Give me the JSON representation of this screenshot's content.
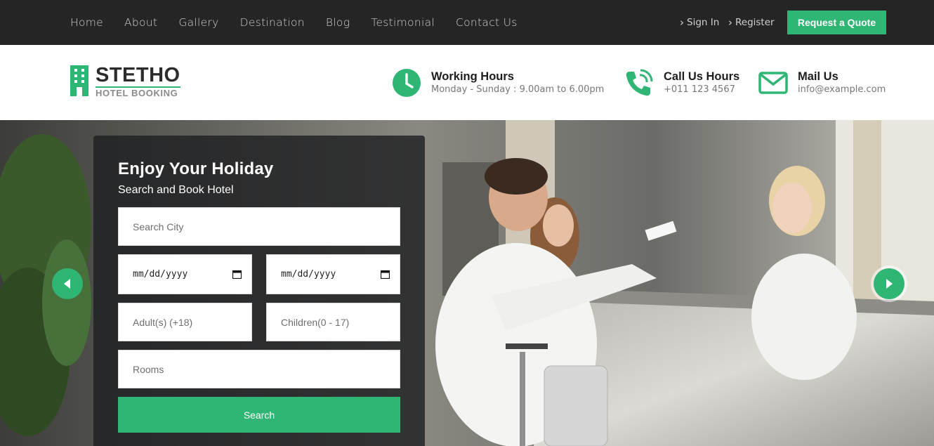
{
  "nav": {
    "items": [
      "Home",
      "About",
      "Gallery",
      "Destination",
      "Blog",
      "Testimonial",
      "Contact Us"
    ],
    "sign_in": "Sign In",
    "register": "Register",
    "quote_button": "Request a Quote"
  },
  "brand": {
    "name": "STETHO",
    "tagline": "HOTEL BOOKING",
    "accent_color": "#2fb574"
  },
  "contact": {
    "hours_title": "Working Hours",
    "hours_value": "Monday - Sunday : 9.00am to 6.00pm",
    "call_title": "Call Us Hours",
    "call_value": "+011 123 4567",
    "mail_title": "Mail Us",
    "mail_value": "info@example.com"
  },
  "booking": {
    "title": "Enjoy Your Holiday",
    "subtitle": "Search and Book Hotel",
    "city_placeholder": "Search City",
    "checkin_value": "mm/dd/yyyy",
    "checkout_value": "mm/dd/yyyy",
    "adults_placeholder": "Adult(s) (+18)",
    "children_placeholder": "Children(0 - 17)",
    "rooms_placeholder": "Rooms",
    "search_label": "Search"
  },
  "icons": {
    "logo": "building-icon",
    "hours": "clock-icon",
    "call": "phone-icon",
    "mail": "envelope-icon",
    "prev": "chevron-left-icon",
    "next": "chevron-right-icon"
  }
}
